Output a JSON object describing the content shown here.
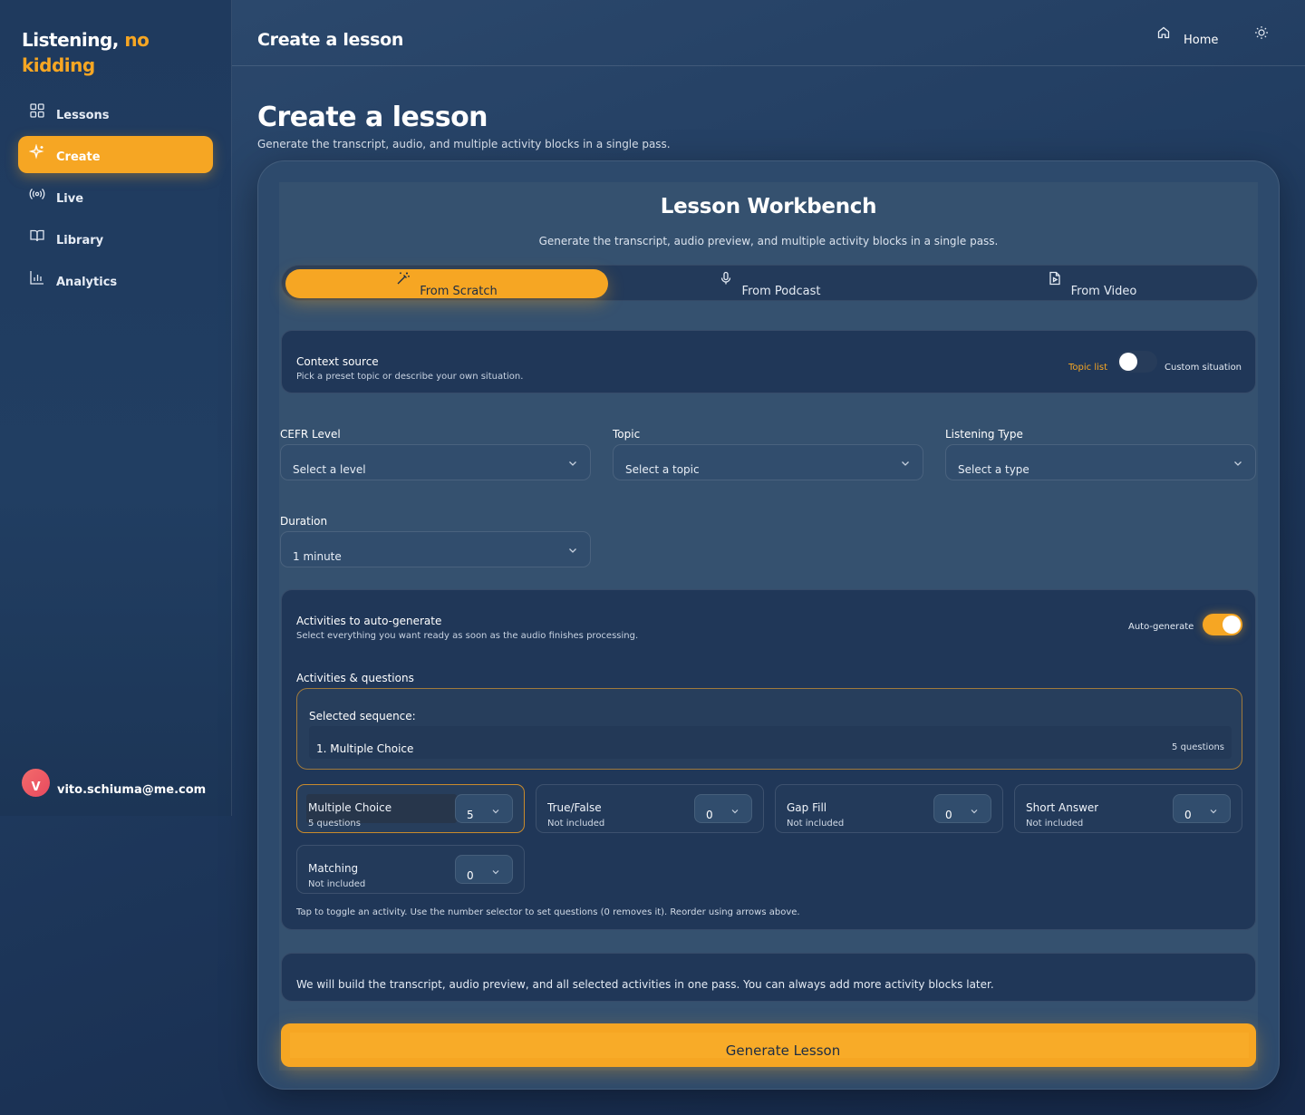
{
  "app": {
    "logo_part1": "Listening,",
    "logo_part2": "no",
    "logo_part3": "kidding",
    "accent_color": "#f6a623"
  },
  "sidebar": {
    "items": [
      {
        "label": "Lessons",
        "icon": "grid-icon",
        "active": false
      },
      {
        "label": "Create",
        "icon": "sparkle-icon",
        "active": true
      },
      {
        "label": "Live",
        "icon": "broadcast-icon",
        "active": false
      },
      {
        "label": "Library",
        "icon": "book-icon",
        "active": false
      },
      {
        "label": "Analytics",
        "icon": "bar-chart-icon",
        "active": false
      }
    ],
    "user": {
      "initial": "V",
      "email": "vito.schiuma@me.com"
    }
  },
  "topbar": {
    "title": "Create a lesson",
    "home_label": "Home",
    "home_icon": "home-icon",
    "theme_icon": "sun-icon"
  },
  "page": {
    "title": "Create a lesson",
    "subtitle": "Generate the transcript, audio, and multiple activity blocks in a single pass."
  },
  "workbench": {
    "title": "Lesson Workbench",
    "subtitle": "Generate the transcript, audio preview, and multiple activity blocks in a single pass.",
    "tabs": [
      {
        "label": "From Scratch",
        "icon": "magic-wand-icon",
        "active": true
      },
      {
        "label": "From Podcast",
        "icon": "microphone-icon",
        "active": false
      },
      {
        "label": "From Video",
        "icon": "video-file-icon",
        "active": false
      }
    ],
    "context": {
      "title": "Context source",
      "subtitle": "Pick a preset topic or describe your own situation.",
      "option_left": "Topic list",
      "option_right": "Custom situation",
      "custom_on": false
    },
    "fields": {
      "cefr": {
        "label": "CEFR Level",
        "value": "Select a level"
      },
      "topic": {
        "label": "Topic",
        "value": "Select a topic"
      },
      "listening_type": {
        "label": "Listening Type",
        "value": "Select a type"
      },
      "duration": {
        "label": "Duration",
        "value": "1 minute"
      }
    },
    "activities": {
      "title": "Activities to auto-generate",
      "subtitle": "Select everything you want ready as soon as the audio finishes processing.",
      "auto_label": "Auto-generate",
      "auto_on": true,
      "section_label": "Activities & questions",
      "sequence_title": "Selected sequence:",
      "sequence": [
        {
          "name": "1. Multiple Choice",
          "count": "5 questions"
        }
      ],
      "items": [
        {
          "name": "Multiple Choice",
          "status": "5 questions",
          "value": "5",
          "selected": true
        },
        {
          "name": "True/False",
          "status": "Not included",
          "value": "0",
          "selected": false
        },
        {
          "name": "Gap Fill",
          "status": "Not included",
          "value": "0",
          "selected": false
        },
        {
          "name": "Short Answer",
          "status": "Not included",
          "value": "0",
          "selected": false
        },
        {
          "name": "Matching",
          "status": "Not included",
          "value": "0",
          "selected": false
        }
      ],
      "help": "Tap to toggle an activity. Use the number selector to set questions (0 removes it). Reorder using arrows above."
    },
    "note": "We will build the transcript, audio preview, and all selected activities in one pass. You can always add more activity blocks later.",
    "generate_label": "Generate Lesson"
  }
}
